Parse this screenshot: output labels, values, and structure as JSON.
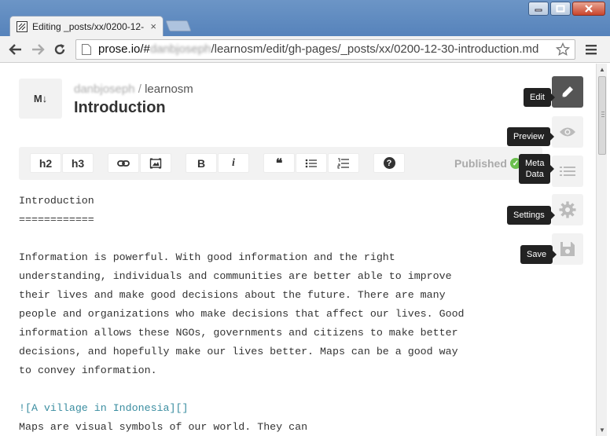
{
  "browser": {
    "tab_title": "Editing _posts/xx/0200-12-",
    "tab_close": "×",
    "url_host": "prose.io/#",
    "url_user": "danbjoseph",
    "url_path": "/learnosm/edit/gh-pages/_posts/xx/0200-12-30-introduction.md"
  },
  "header": {
    "md_icon": "M↓",
    "user": "danbjoseph",
    "separator": "/",
    "repo": "learnosm",
    "title": "Introduction"
  },
  "editor_toolbar": {
    "h2": "h2",
    "h3": "h3",
    "bold": "B",
    "italic": "i",
    "quote": "❝",
    "help": "?",
    "status": "Published"
  },
  "content": {
    "line1": "Introduction",
    "line2": "============",
    "para1": "Information is powerful. With good information and the right\nunderstanding, individuals and communities are better able to improve\ntheir lives and make good decisions about the future. There are many\npeople and organizations who make decisions that affect our lives. Good\ninformation allows these NGOs, governments and citizens to make better\ndecisions, and hopefully make our lives better. Maps can be a good way\nto convey information.",
    "image_link": "![A village in Indonesia][]",
    "para2": "Maps are visual symbols of our world. They can"
  },
  "rail": {
    "edit": "Edit",
    "preview": "Preview",
    "meta": "Meta\nData",
    "settings": "Settings",
    "save": "Save"
  },
  "colors": {
    "active_rail": "#555555",
    "published_check": "#6bbf4e",
    "link_text": "#3a8da0"
  }
}
